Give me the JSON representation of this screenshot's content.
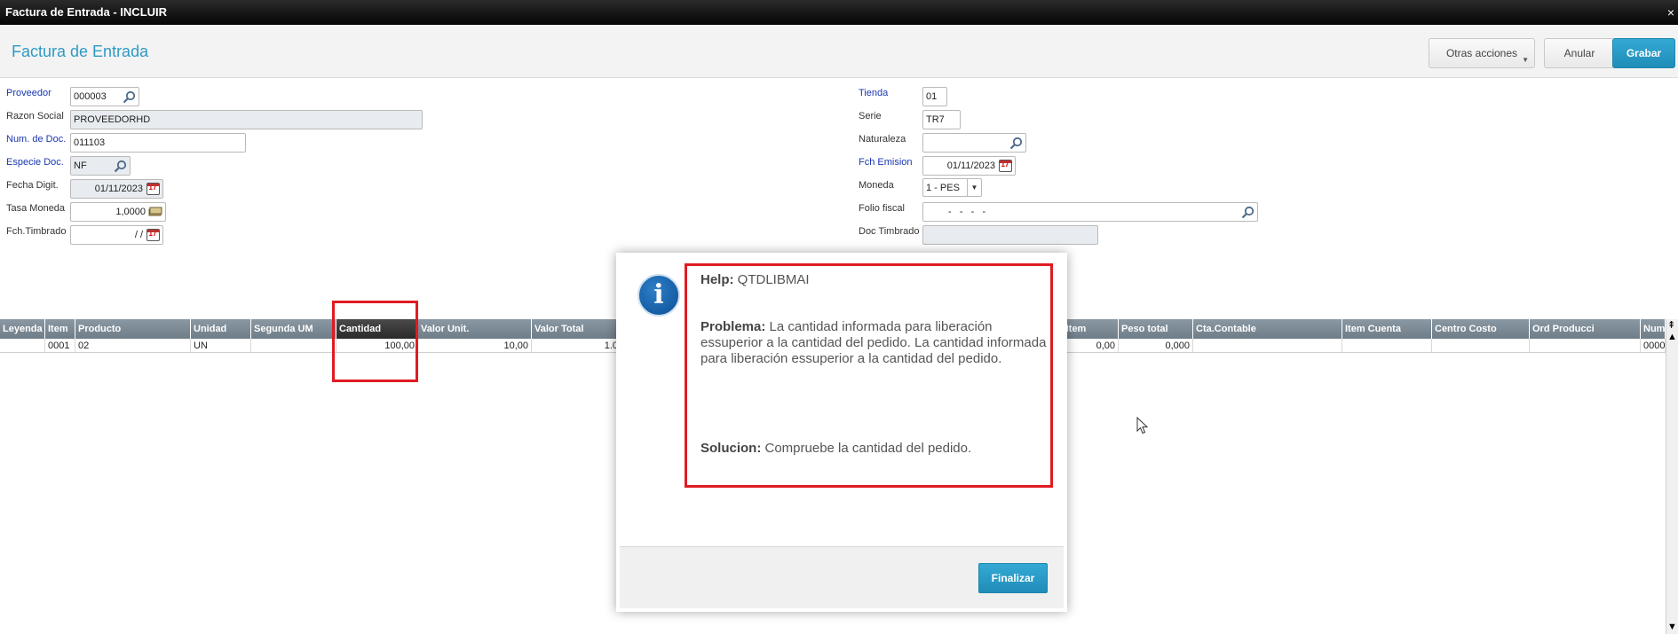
{
  "window": {
    "title": "Factura de Entrada - INCLUIR",
    "close": "×"
  },
  "header": {
    "title": "Factura de Entrada",
    "btn_otras": "Otras acciones",
    "btn_anular": "Anular",
    "btn_grabar": "Grabar"
  },
  "form": {
    "proveedor": {
      "label": "Proveedor",
      "value": "000003"
    },
    "razon": {
      "label": "Razon Social",
      "value": "PROVEEDORHD"
    },
    "numdoc": {
      "label": "Num. de Doc.",
      "value": "011103"
    },
    "especie": {
      "label": "Especie Doc.",
      "value": "NF"
    },
    "fechadigit": {
      "label": "Fecha Digit.",
      "value": "01/11/2023"
    },
    "tasa": {
      "label": "Tasa Moneda",
      "value": "1,0000"
    },
    "fchtimbrado": {
      "label": "Fch.Timbrado",
      "value": "/ /"
    },
    "tienda": {
      "label": "Tienda",
      "value": "01"
    },
    "serie": {
      "label": "Serie",
      "value": "TR7"
    },
    "naturaleza": {
      "label": "Naturaleza",
      "value": ""
    },
    "fchemision": {
      "label": "Fch Emision",
      "value": "01/11/2023"
    },
    "moneda": {
      "label": "Moneda",
      "value": "1 - PES"
    },
    "folio": {
      "label": "Folio fiscal",
      "value": "-   -   -   -"
    },
    "doctimbrado": {
      "label": "Doc Timbrado",
      "value": ""
    }
  },
  "grid": {
    "headers": [
      "Leyenda",
      "Item",
      "Producto",
      "Unidad",
      "Segunda UM",
      "Cantidad",
      "Valor Unit.",
      "Valor Total",
      "t.Item",
      "Peso total",
      "Cta.Contable",
      "Item Cuenta",
      "Centro Costo",
      "Ord Producci",
      "Num"
    ],
    "row": [
      "",
      "0001",
      "02",
      "UN",
      "",
      "100,00",
      "10,00",
      "1.0",
      "0,00",
      "0,000",
      "",
      "",
      "",
      "",
      "0000"
    ]
  },
  "dialog": {
    "help_label": "Help:",
    "help_value": "QTDLIBMAI",
    "problema_label": "Problema:",
    "problema_text": "La cantidad informada para liberación essuperior a la cantidad del pedido. La cantidad informada para liberación essuperior a la cantidad del pedido.",
    "solucion_label": "Solucion:",
    "solucion_text": "Compruebe la cantidad del pedido.",
    "button": "Finalizar",
    "icon": "info-icon"
  },
  "colors": {
    "accent": "#2e9ac5",
    "highlight": "#e01b22",
    "grid_header": "#7a8894"
  }
}
